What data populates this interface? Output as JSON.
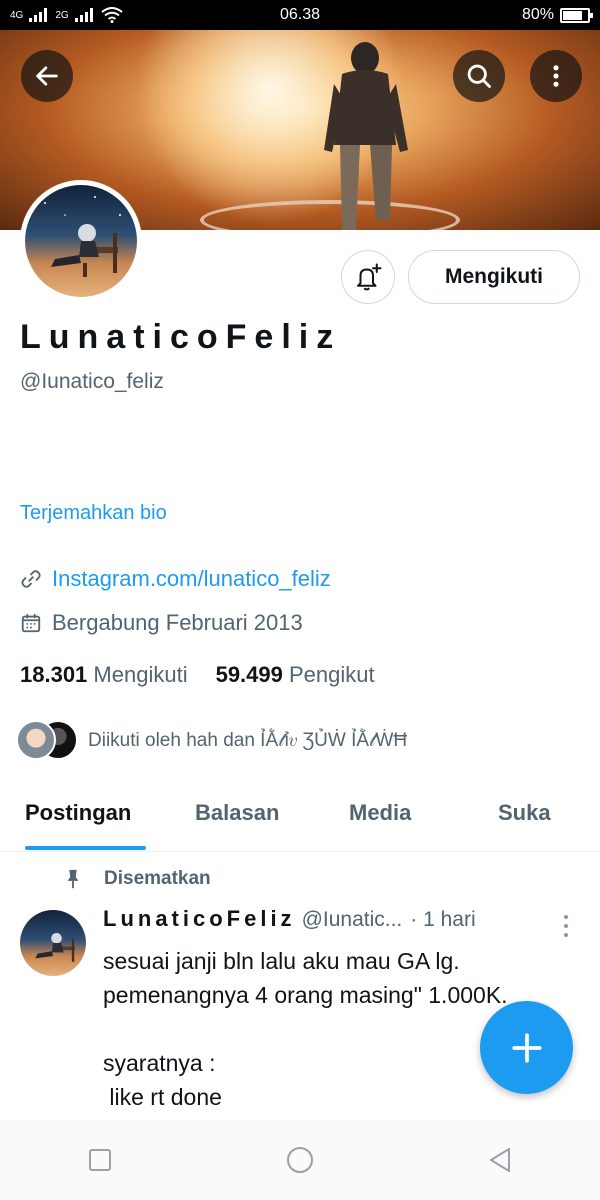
{
  "status_bar": {
    "signal_1": "4G",
    "signal_2": "2G",
    "time": "06.38",
    "battery_percent": "80%",
    "battery_level": 0.8
  },
  "banner": {
    "back_icon": "arrow-left-icon",
    "search_icon": "search-icon",
    "more_icon": "more-vertical-icon"
  },
  "profile": {
    "display_name": "LunaticoFeliz",
    "handle": "@Iunatico_feliz",
    "translate_bio": "Terjemahkan bio",
    "link": "Instagram.com/lunatico_feliz",
    "joined": "Bergabung Februari 2013",
    "following_count": "18.301",
    "following_label": "Mengikuti",
    "followers_count": "59.499",
    "followers_label": "Pengikut",
    "followed_by": "Diikuti oleh hah dan ỈẰ𝓉ỉ𝑣 ƷỦẆ ỈẰ𝓉ẆĦ"
  },
  "actions": {
    "bell_icon": "bell-plus-icon",
    "follow_label": "Mengikuti"
  },
  "tabs": [
    {
      "label": "Postingan"
    },
    {
      "label": "Balasan"
    },
    {
      "label": "Media"
    },
    {
      "label": "Suka"
    }
  ],
  "pinned_tweet": {
    "pinned_label": "Disematkan",
    "name": "LunaticoFeliz",
    "handle": "@Iunatic...",
    "time": "· 1 hari",
    "lines": [
      "sesuai janji bln lalu aku mau GA lg.",
      "pemenangnya 4 orang masing\" 1.000K.",
      "",
      "syaratnya :",
      " like rt done"
    ]
  },
  "colors": {
    "accent": "#1d9bf0",
    "text_primary": "#0f1419",
    "text_secondary": "#536471"
  }
}
